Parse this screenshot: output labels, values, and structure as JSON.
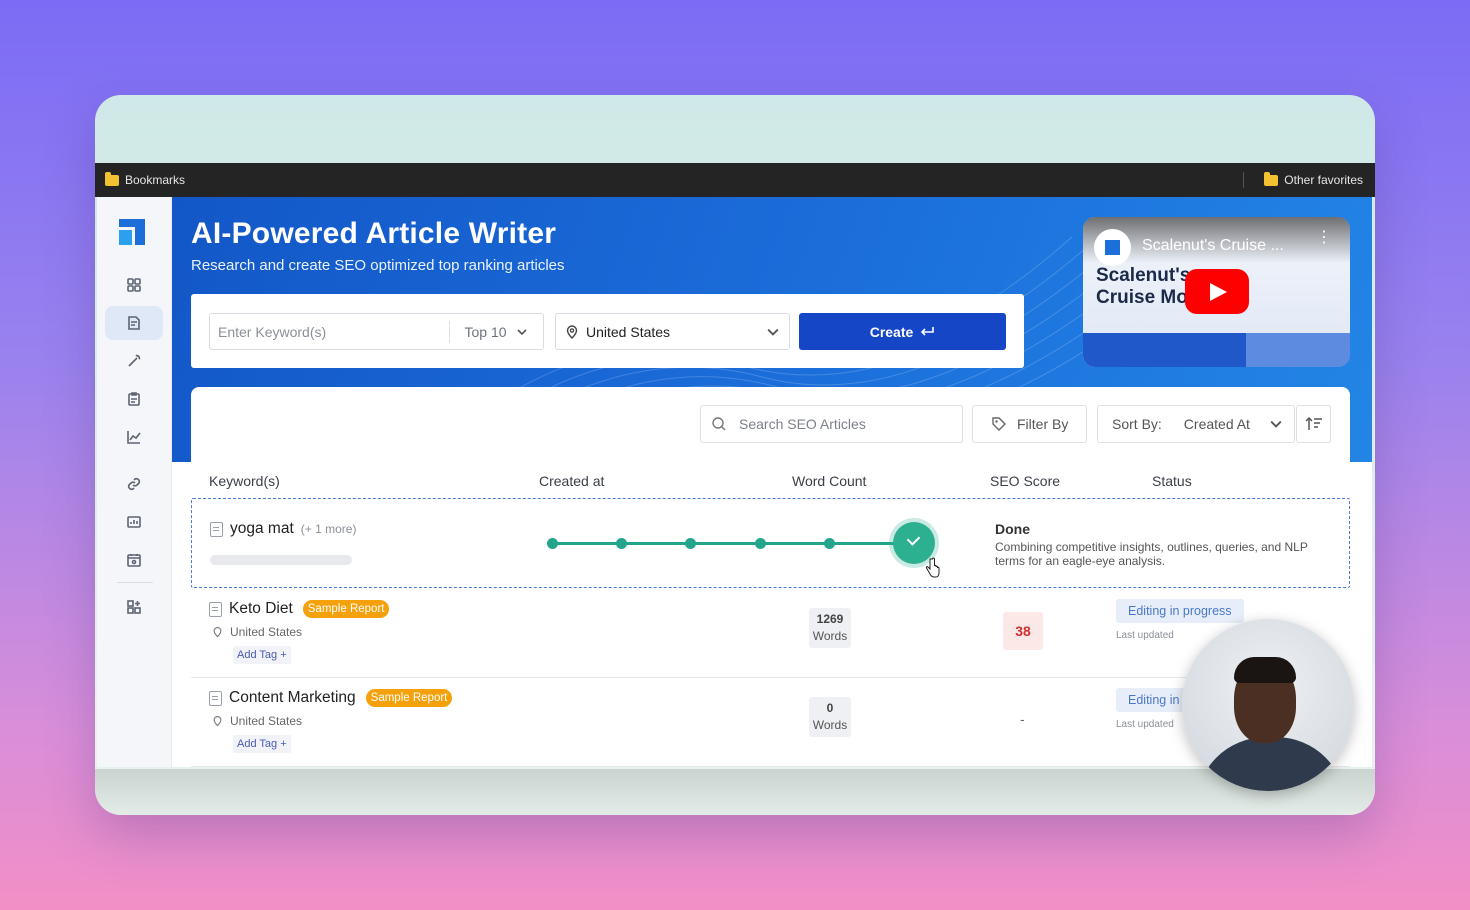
{
  "browser": {
    "bookmarks_label": "Bookmarks",
    "other_favorites_label": "Other favorites"
  },
  "hero": {
    "title": "AI-Powered Article Writer",
    "subtitle": "Research and create SEO optimized top ranking articles"
  },
  "create_form": {
    "keyword_placeholder": "Enter Keyword(s)",
    "top_value": "Top 10",
    "location_value": "United States",
    "create_label": "Create"
  },
  "video": {
    "title": "Scalenut's Cruise ...",
    "thumb_line1": "Scalenut's",
    "thumb_line2": "Cruise Mo"
  },
  "toolbar": {
    "search_placeholder": "Search SEO Articles",
    "filter_label": "Filter By",
    "sort_label": "Sort By:",
    "sort_value": "Created At"
  },
  "table": {
    "headers": [
      "Keyword(s)",
      "Created at",
      "Word Count",
      "SEO Score",
      "Status"
    ],
    "active_row": {
      "keyword": "yoga mat",
      "more": "(+ 1 more)",
      "progress_steps": 6,
      "progress_done_steps": 6,
      "status_title": "Done",
      "status_desc": "Combining competitive insights, outlines, queries, and NLP terms for an eagle-eye analysis."
    },
    "rows": [
      {
        "keyword": "Keto Diet",
        "badge": "Sample Report",
        "location": "United States",
        "add_tag": "Add Tag +",
        "word_count": "1269",
        "word_unit": "Words",
        "seo_score": "38",
        "status": "Editing in progress",
        "last_updated": "Last updated"
      },
      {
        "keyword": "Content Marketing",
        "badge": "Sample Report",
        "location": "United States",
        "add_tag": "Add Tag +",
        "word_count": "0",
        "word_unit": "Words",
        "seo_score": "-",
        "status": "Editing in",
        "last_updated": "Last updated"
      }
    ]
  },
  "colors": {
    "brand_blue": "#1446c6",
    "hero_blue": "#1a6ad8",
    "progress_green": "#22a58a",
    "badge_orange": "#f5a10b",
    "score_red": "#d03030"
  }
}
